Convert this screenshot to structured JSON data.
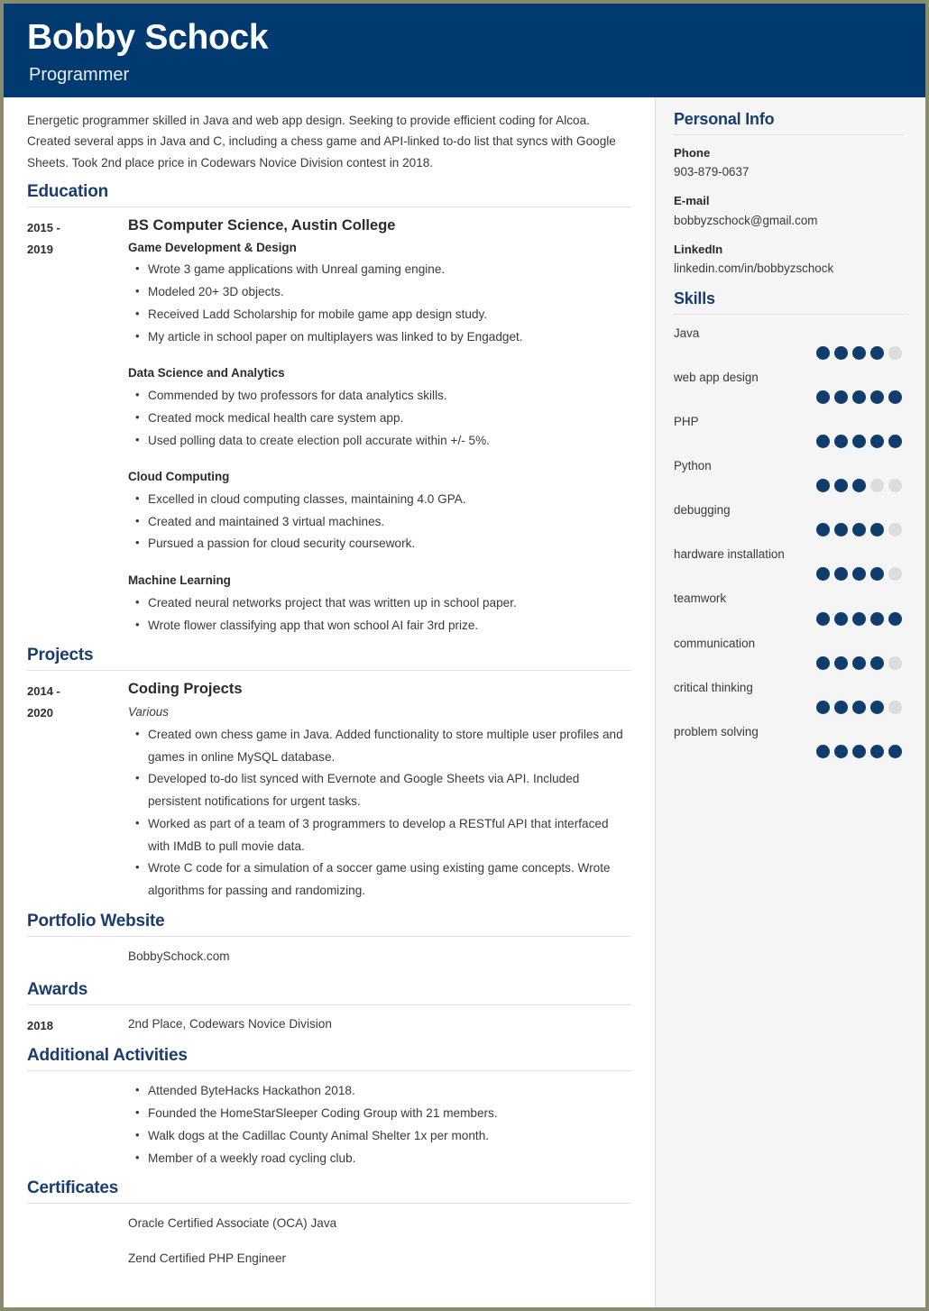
{
  "theme": {
    "header_bg": "#013a71",
    "accent": "#1a3d6d",
    "dot_active": "#0f3d6e",
    "dot_inactive": "#dcdcdc",
    "sidebar_bg": "#f5f5f5",
    "page_border": "#8a8a6e"
  },
  "header": {
    "name": "Bobby Schock",
    "job_title": "Programmer"
  },
  "summary": "Energetic programmer skilled in Java and web app design. Seeking to provide efficient coding for Alcoa. Created several apps in Java and C, including a chess game and API-linked to-do list that syncs with Google Sheets. Took 2nd place price in Codewars Novice Division contest in 2018.",
  "sections": {
    "education": {
      "title": "Education",
      "date": "2015 - 2019",
      "date_line1": "2015 -",
      "date_line2": "2019",
      "degree": "BS Computer Science, Austin College",
      "groups": [
        {
          "heading": "Game Development & Design",
          "bullets": [
            "Wrote 3 game applications with Unreal gaming engine.",
            "Modeled 20+ 3D objects.",
            "Received Ladd Scholarship for mobile game app design study.",
            "My article in school paper on multiplayers was linked to by Engadget."
          ]
        },
        {
          "heading": "Data Science and Analytics",
          "bullets": [
            "Commended by two professors for data analytics skills.",
            "Created mock medical health care system app.",
            "Used polling data to create election poll accurate within +/- 5%."
          ]
        },
        {
          "heading": "Cloud Computing",
          "bullets": [
            "Excelled in cloud computing classes, maintaining 4.0 GPA.",
            "Created and maintained 3 virtual machines.",
            "Pursued a passion for cloud security coursework."
          ]
        },
        {
          "heading": "Machine Learning",
          "bullets": [
            "Created neural networks project that was written up in school paper.",
            "Wrote flower classifying app that won school AI fair 3rd prize."
          ]
        }
      ]
    },
    "projects": {
      "title": "Projects",
      "date_line1": "2014 -",
      "date_line2": "2020",
      "heading": "Coding Projects",
      "subtitle": "Various",
      "bullets": [
        "Created own chess game in Java. Added functionality to store multiple user profiles and games in online MySQL database.",
        "Developed to-do list synced with Evernote and Google Sheets via API. Included persistent notifications for urgent tasks.",
        "Worked as part of a team of 3 programmers to develop a RESTful API that interfaced with IMdB to pull movie data.",
        "Wrote C code for a simulation of a soccer game using existing game concepts. Wrote algorithms for passing and randomizing."
      ]
    },
    "portfolio": {
      "title": "Portfolio Website",
      "value": "BobbySchock.com"
    },
    "awards": {
      "title": "Awards",
      "date": "2018",
      "value": "2nd Place, Codewars Novice Division"
    },
    "activities": {
      "title": "Additional Activities",
      "bullets": [
        "Attended ByteHacks Hackathon 2018.",
        "Founded the HomeStarSleeper Coding Group with 21 members.",
        "Walk dogs at the Cadillac County Animal Shelter 1x per month.",
        "Member of a weekly road cycling club."
      ]
    },
    "certificates": {
      "title": "Certificates",
      "items": [
        "Oracle Certified Associate (OCA) Java",
        "Zend Certified PHP Engineer"
      ]
    }
  },
  "sidebar": {
    "personal_info": {
      "title": "Personal Info",
      "fields": [
        {
          "label": "Phone",
          "value": "903-879-0637"
        },
        {
          "label": "E-mail",
          "value": "bobbyzschock@gmail.com"
        },
        {
          "label": "LinkedIn",
          "value": "linkedin.com/in/bobbyzschock"
        }
      ]
    },
    "skills": {
      "title": "Skills",
      "max_rating": 5,
      "items": [
        {
          "name": "Java",
          "rating": 4
        },
        {
          "name": "web app design",
          "rating": 5
        },
        {
          "name": "PHP",
          "rating": 5
        },
        {
          "name": "Python",
          "rating": 3
        },
        {
          "name": "debugging",
          "rating": 4
        },
        {
          "name": "hardware installation",
          "rating": 4
        },
        {
          "name": "teamwork",
          "rating": 5
        },
        {
          "name": "communication",
          "rating": 4
        },
        {
          "name": "critical thinking",
          "rating": 4
        },
        {
          "name": "problem solving",
          "rating": 5
        }
      ]
    }
  }
}
